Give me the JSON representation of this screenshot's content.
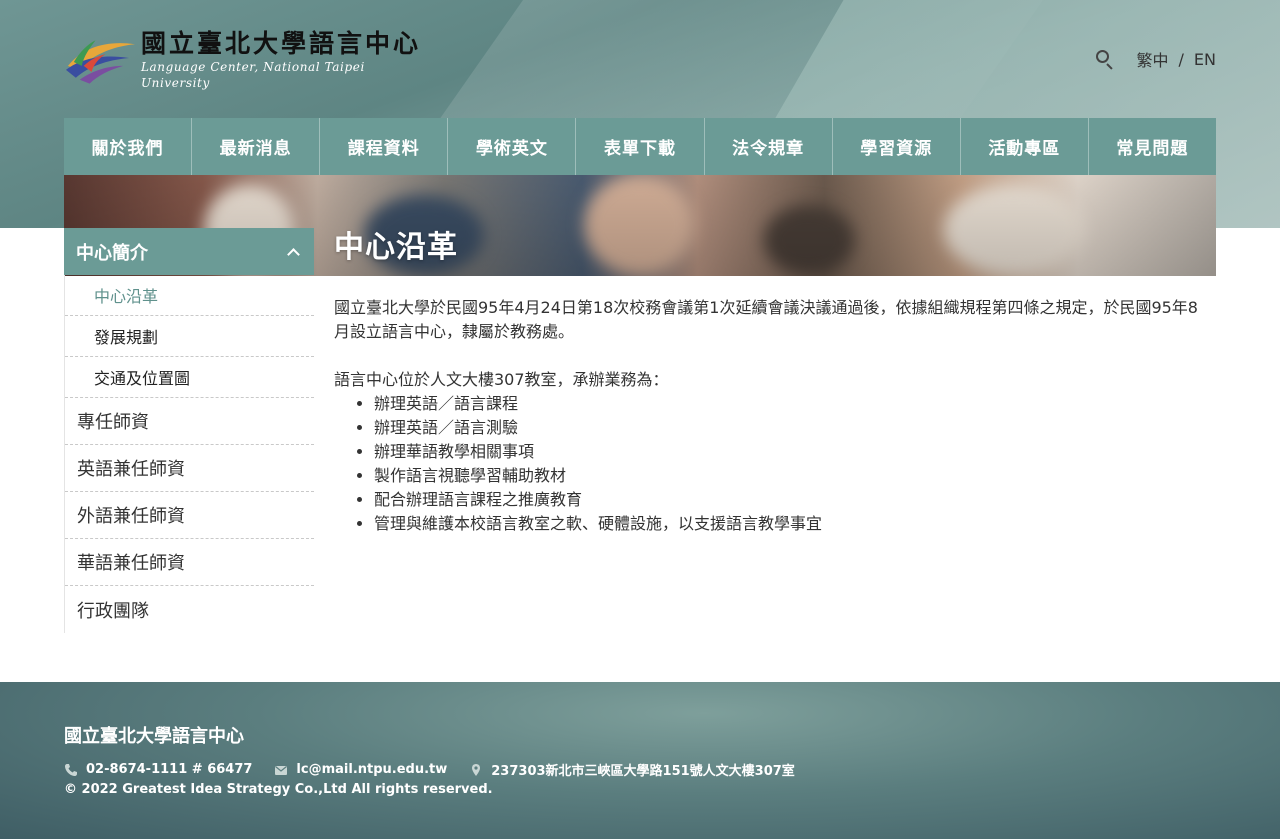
{
  "header": {
    "logo_zh": "國立臺北大學語言中心",
    "logo_en": "Language Center, National Taipei University",
    "lang_zh": "繁中",
    "lang_sep": "/",
    "lang_en": "EN"
  },
  "nav": {
    "items": [
      {
        "label": "關於我們"
      },
      {
        "label": "最新消息"
      },
      {
        "label": "課程資料"
      },
      {
        "label": "學術英文"
      },
      {
        "label": "表單下載"
      },
      {
        "label": "法令規章"
      },
      {
        "label": "學習資源"
      },
      {
        "label": "活動專區"
      },
      {
        "label": "常見問題"
      }
    ]
  },
  "sidebar": {
    "head": "中心簡介",
    "sub_items": [
      {
        "label": "中心沿革"
      },
      {
        "label": "發展規劃"
      },
      {
        "label": "交通及位置圖"
      }
    ],
    "items": [
      {
        "label": "專任師資"
      },
      {
        "label": "英語兼任師資"
      },
      {
        "label": "外語兼任師資"
      },
      {
        "label": "華語兼任師資"
      },
      {
        "label": "行政團隊"
      }
    ]
  },
  "page": {
    "title": "中心沿革",
    "para1": "國立臺北大學於民國95年4月24日第18次校務會議第1次延續會議決議通過後，依據組織規程第四條之規定，於民國95年8月設立語言中心，隸屬於教務處。",
    "para2": "語言中心位於人文大樓307教室，承辦業務為：",
    "list": [
      "辦理英語／語言課程",
      "辦理英語／語言測驗",
      "辦理華語教學相關事項",
      "製作語言視聽學習輔助教材",
      "配合辦理語言課程之推廣教育",
      "管理與維護本校語言教室之軟、硬體設施，以支援語言教學事宜"
    ]
  },
  "footer": {
    "title": "國立臺北大學語言中心",
    "phone": "02-8674-1111 # 66477",
    "email": "lc@mail.ntpu.edu.tw",
    "address": "237303新北市三峽區大學路151號人文大樓307室",
    "copyright": "© 2022 Greatest Idea Strategy Co.,Ltd All rights reserved."
  },
  "colors": {
    "accent": "#6b9b96",
    "active_link": "#5f918c"
  },
  "icons": [
    "logo-mark-icon",
    "search-icon",
    "chevron-up-icon",
    "phone-icon",
    "mail-icon",
    "location-pin-icon"
  ]
}
